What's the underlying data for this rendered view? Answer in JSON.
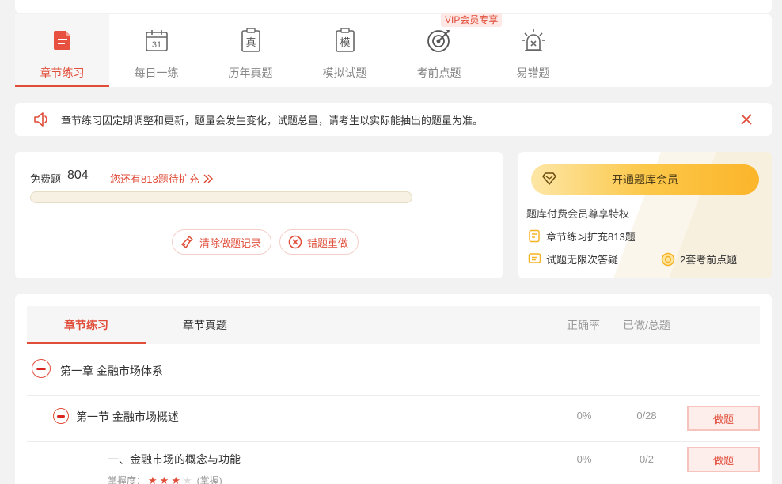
{
  "modes": [
    {
      "label": "章节练习",
      "icon": "chapter-doc-icon",
      "active": true
    },
    {
      "label": "每日一练",
      "icon": "calendar-icon",
      "calendar_day": "31"
    },
    {
      "label": "历年真题",
      "icon": "clipboard-icon",
      "glyph": "真"
    },
    {
      "label": "模拟试题",
      "icon": "clipboard-icon",
      "glyph": "模"
    },
    {
      "label": "考前点题",
      "icon": "target-icon"
    },
    {
      "label": "易错题",
      "icon": "alert-beacon-icon"
    }
  ],
  "vip_tag": "VIP会员专享",
  "notice": {
    "text": "章节练习因定期调整和更新，题量会发生变化，试题总量，请考生以实际能抽出的题量为准。"
  },
  "stats": {
    "free_label": "免费题",
    "free_count": "804",
    "expand_text": "您还有813题待扩充",
    "progress_fraction": 0,
    "clear_label": "清除做题记录",
    "redo_label": "错题重做"
  },
  "vip_card": {
    "button_label": "开通题库会员",
    "title": "题库付费会员尊享特权",
    "perks": [
      "章节练习扩充813题",
      "试题无限次答疑",
      "2套考前点题"
    ]
  },
  "list": {
    "tabs": [
      "章节练习",
      "章节真题"
    ],
    "columns": {
      "accuracy": "正确率",
      "done_total": "已做/总题"
    },
    "chapter": {
      "title": "第一章 金融市场体系"
    },
    "section": {
      "title": "第一节 金融市场概述",
      "accuracy": "0%",
      "done_total": "0/28",
      "button": "做题"
    },
    "point": {
      "title": "一、金融市场的概念与功能",
      "accuracy": "0%",
      "done_total": "0/2",
      "button": "做题",
      "mastery_label": "掌握度：",
      "stars_filled": 3,
      "stars_total": 4,
      "mastery_text": "(掌握)"
    }
  },
  "colors": {
    "accent": "#e04e3a",
    "vip_gold": "#fbb52a"
  }
}
